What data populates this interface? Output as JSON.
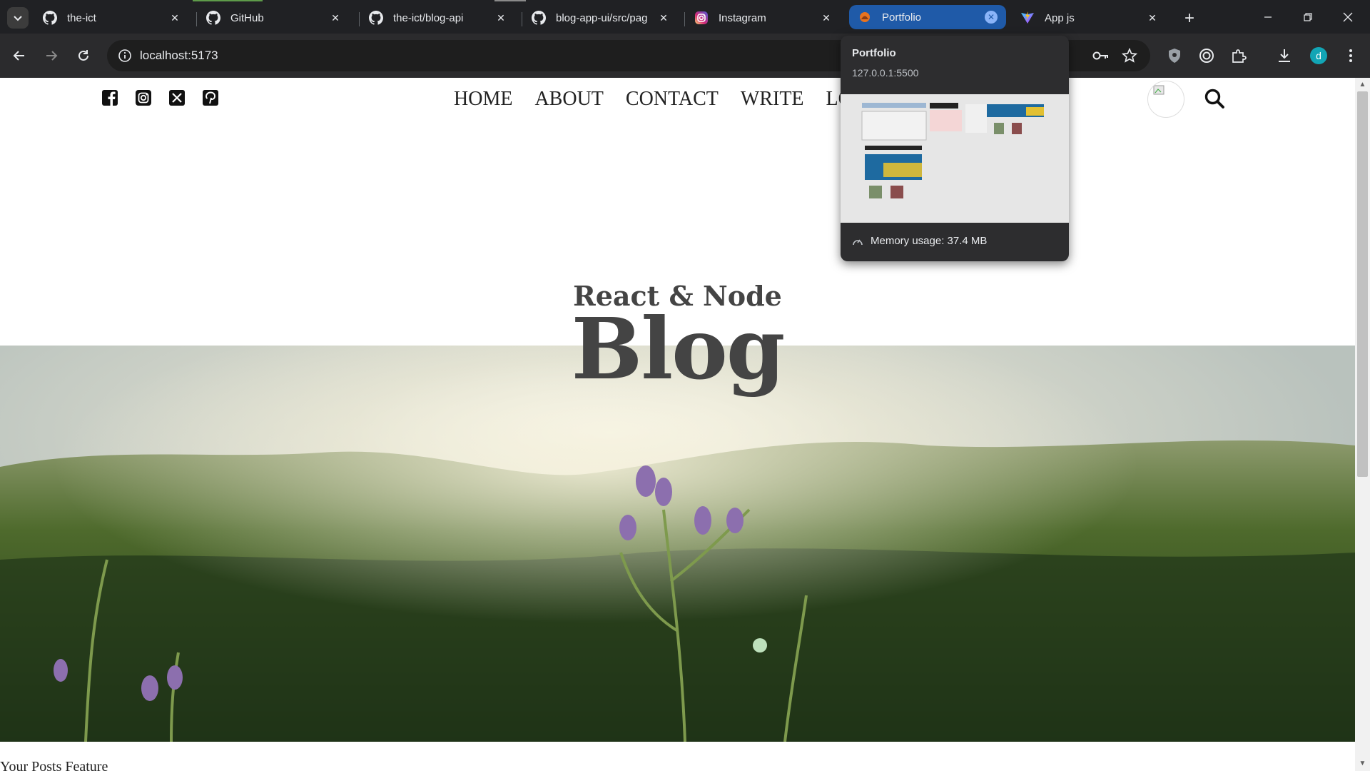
{
  "browser": {
    "tabs": [
      {
        "title": "the-ict",
        "favicon": "github-icon"
      },
      {
        "title": "GitHub",
        "favicon": "github-icon"
      },
      {
        "title": "the-ict/blog-api",
        "favicon": "github-icon"
      },
      {
        "title": "blog-app-ui/src/pag",
        "favicon": "github-icon"
      },
      {
        "title": "Instagram",
        "favicon": "instagram-icon"
      },
      {
        "title": "Portfolio",
        "favicon": "portfolio-icon",
        "active": true
      },
      {
        "title": "App js",
        "favicon": "vite-icon"
      }
    ],
    "address": "localhost:5173",
    "profile_initial": "d",
    "accent_color": "#1f5aa8"
  },
  "hover_card": {
    "title": "Portfolio",
    "url": "127.0.0.1:5500",
    "memory": "Memory usage: 37.4 MB"
  },
  "page": {
    "social_icons": [
      "facebook-icon",
      "instagram-icon",
      "x-icon",
      "pinterest-icon"
    ],
    "menu": [
      "HOME",
      "ABOUT",
      "CONTACT",
      "WRITE",
      "LOGOUT"
    ],
    "header_small": "React & Node",
    "header_large": "Blog",
    "bottom_text": "Your Posts Feature"
  }
}
